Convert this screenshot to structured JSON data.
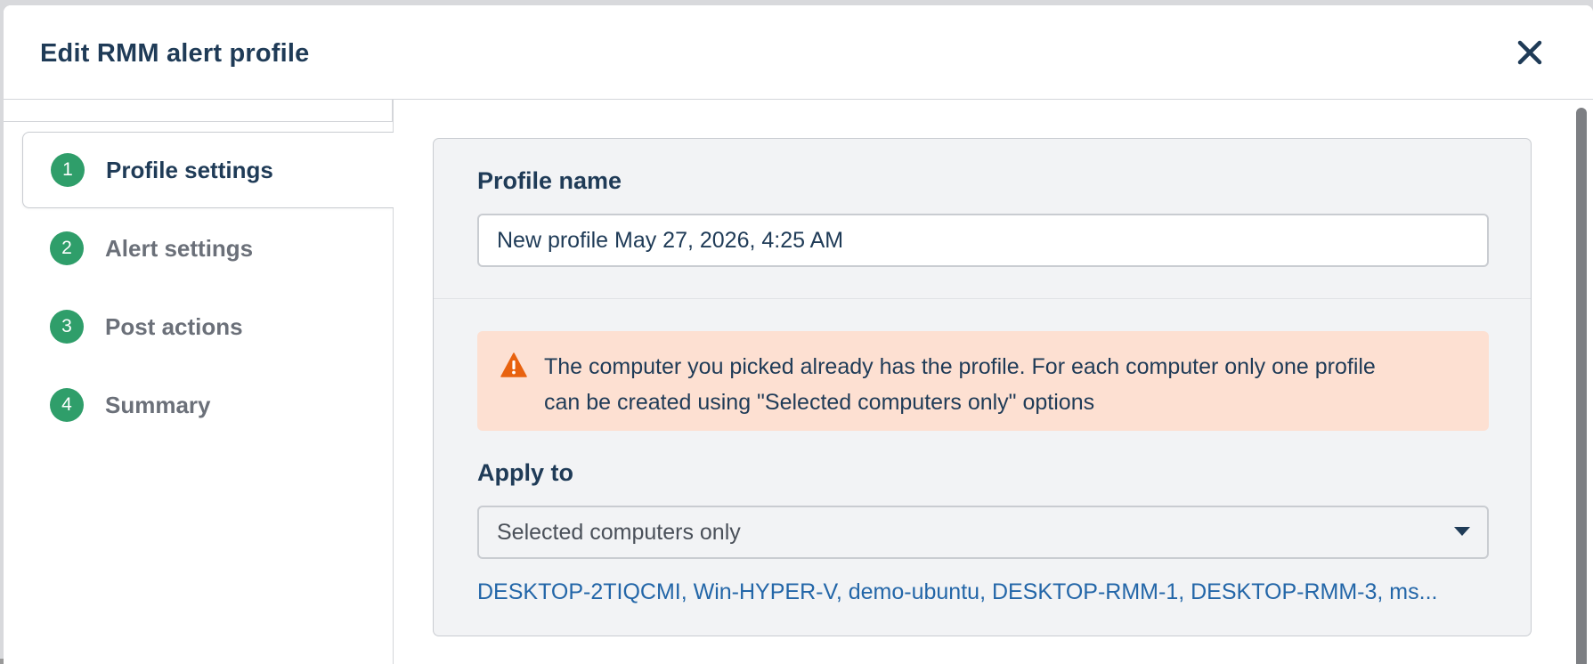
{
  "modal": {
    "title": "Edit RMM alert profile",
    "close_icon": "close-icon"
  },
  "steps": [
    {
      "number": "1",
      "label": "Profile settings",
      "active": true
    },
    {
      "number": "2",
      "label": "Alert settings",
      "active": false
    },
    {
      "number": "3",
      "label": "Post actions",
      "active": false
    },
    {
      "number": "4",
      "label": "Summary",
      "active": false
    }
  ],
  "form": {
    "profile_name_label": "Profile name",
    "profile_name_value": "New profile May 27, 2026, 4:25 AM",
    "warning_icon": "warning-icon",
    "warning_text_line1": "The computer you picked already has the profile. For each computer only one profile",
    "warning_text_line2": "can be created using \"Selected computers only\" options",
    "apply_to_label": "Apply to",
    "apply_to_value": "Selected computers only",
    "computers_link": "DESKTOP-2TIQCMI, Win-HYPER-V, demo-ubuntu, DESKTOP-RMM-1, DESKTOP-RMM-3, ms..."
  },
  "colors": {
    "title": "#1f3b57",
    "step_badge": "#2f9e6a",
    "warning_bg": "#fde0d2",
    "warning_icon": "#e8620f",
    "link": "#2366a8",
    "panel_bg": "#f2f3f5"
  }
}
